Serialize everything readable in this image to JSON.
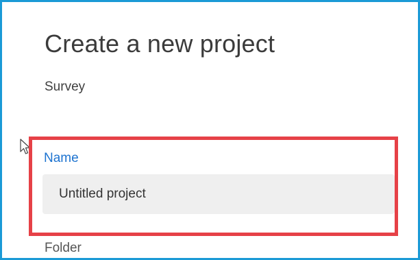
{
  "dialog": {
    "title": "Create a new project",
    "project_type": "Survey"
  },
  "name_field": {
    "label": "Name",
    "value": "Untitled project"
  },
  "folder_field": {
    "label": "Folder"
  },
  "colors": {
    "frame_border": "#1b9ad6",
    "highlight_border": "#e64147",
    "accent_label": "#1d73d0",
    "input_background": "#efefef"
  },
  "icons": {
    "cursor": "mouse-pointer-icon"
  }
}
